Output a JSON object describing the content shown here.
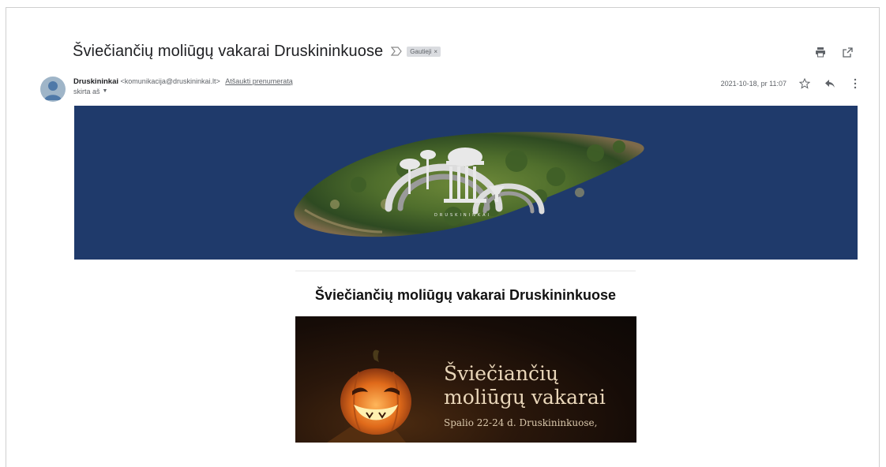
{
  "email": {
    "subject": "Šviečiančių moliūgų vakarai Druskininkuose",
    "label": "Gautieji",
    "label_remove": "×",
    "sender_name": "Druskininkai",
    "sender_email": "<komunikacija@druskininkai.lt>",
    "unsubscribe": "Atšaukti prenumeratą",
    "to_line": "skirta aš",
    "date": "2021-10-18, pr 11:07"
  },
  "icons": {
    "print": "print-icon",
    "open_new_window": "open-in-new-window-icon",
    "star": "star-icon",
    "reply": "reply-icon",
    "more": "more-vertical-icon",
    "important": "important-marker-icon",
    "avatar": "avatar-icon"
  },
  "banner": {
    "logo_text": "DRUSKININKAI",
    "background": "#1f3a6b"
  },
  "content": {
    "title": "Šviečiančių moliūgų vakarai Druskininkuose",
    "hero_line1": "Šviečiančių",
    "hero_line2": "moliūgų vakarai",
    "hero_sub": "Spalio 22-24 d. Druskininkuose,"
  }
}
